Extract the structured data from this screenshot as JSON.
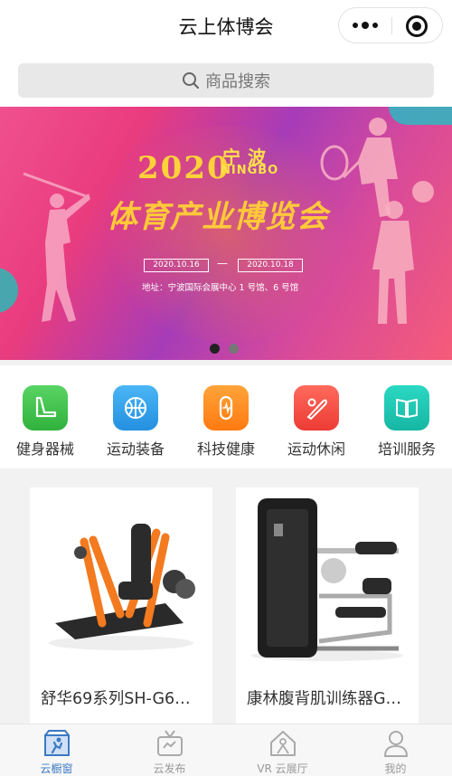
{
  "header": {
    "title": "云上体博会"
  },
  "search": {
    "placeholder": "商品搜索"
  },
  "banner": {
    "year": "2020",
    "city": "宁波",
    "city_en": "NINGBO",
    "headline": "体育产业博览会",
    "date_start": "2020.10.16",
    "date_sep": "—",
    "date_end": "2020.10.18",
    "address": "地址：宁波国际会展中心 1 号馆、6 号馆",
    "active_slide": 1,
    "slide_count": 2
  },
  "categories": [
    {
      "label": "健身器械",
      "icon": "treadmill-icon",
      "color": "#3dc04b"
    },
    {
      "label": "运动装备",
      "icon": "basketball-icon",
      "color": "#2f9fe9"
    },
    {
      "label": "科技健康",
      "icon": "smart-band-icon",
      "color": "#ff8a1d"
    },
    {
      "label": "运动休闲",
      "icon": "baseball-bat-icon",
      "color": "#f4473e"
    },
    {
      "label": "培训服务",
      "icon": "book-icon",
      "color": "#1ec7b3"
    }
  ],
  "products": [
    {
      "name": "舒华69系列SH-G6…"
    },
    {
      "name": "康林腹背肌训练器G…"
    }
  ],
  "tabbar": [
    {
      "label": "云橱窗",
      "icon": "storefront-icon",
      "active": true
    },
    {
      "label": "云发布",
      "icon": "tv-icon",
      "active": false
    },
    {
      "label": "VR 云展厅",
      "icon": "house-icon",
      "active": false
    },
    {
      "label": "我的",
      "icon": "user-icon",
      "active": false
    }
  ],
  "colors": {
    "accent": "#3b79c4",
    "banner_text": "#ffc93a"
  }
}
